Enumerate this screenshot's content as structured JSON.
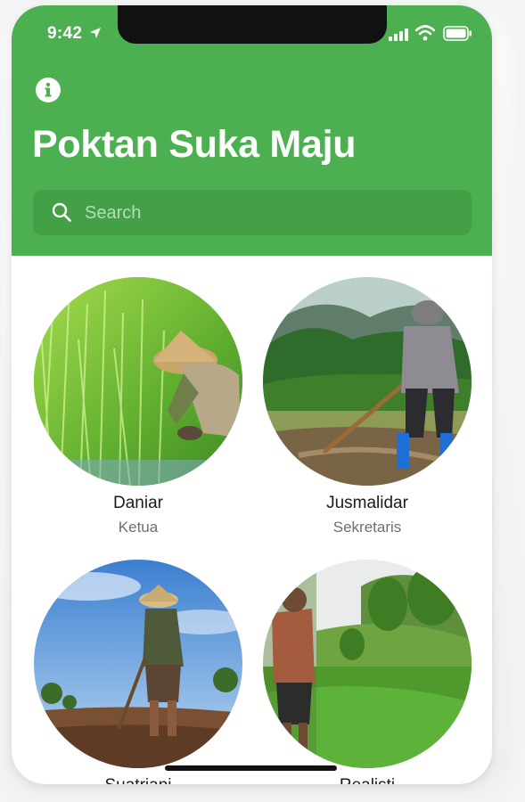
{
  "status_bar": {
    "time": "9:42"
  },
  "app": {
    "title": "Poktan Suka Maju",
    "search_placeholder": "Search"
  },
  "members": [
    {
      "name": "Daniar",
      "role": "Ketua"
    },
    {
      "name": "Jusmalidar",
      "role": "Sekretaris"
    },
    {
      "name": "Suatriani",
      "role": ""
    },
    {
      "name": "Realisti",
      "role": ""
    }
  ],
  "colors": {
    "header_green": "#4caf50",
    "search_green": "#43a047",
    "background": "#ffffff"
  }
}
